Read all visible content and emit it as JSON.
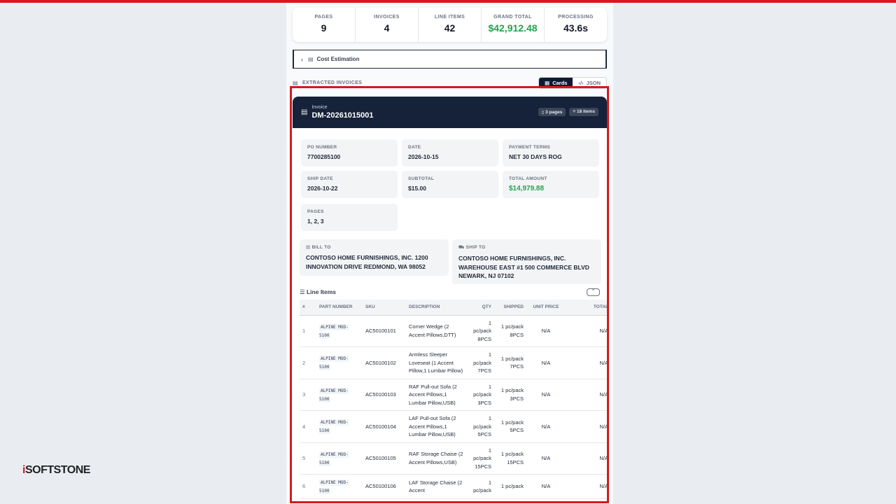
{
  "stats": [
    {
      "label": "PAGES",
      "value": "9"
    },
    {
      "label": "INVOICES",
      "value": "4"
    },
    {
      "label": "LINE ITEMS",
      "value": "42"
    },
    {
      "label": "GRAND TOTAL",
      "value": "$42,912.48"
    },
    {
      "label": "PROCESSING",
      "value": "43.6s"
    }
  ],
  "cost_estimation": {
    "label": "Cost Estimation"
  },
  "section": {
    "title": "EXTRACTED INVOICES",
    "cards_label": "Cards",
    "json_label": "JSON"
  },
  "invoice": {
    "kind": "Invoice",
    "number": "DM-20261015001",
    "pages_badge": "3 pages",
    "items_badge": "18 items",
    "fields": {
      "po_number": {
        "label": "PO NUMBER",
        "value": "7700285100"
      },
      "date": {
        "label": "DATE",
        "value": "2026-10-15"
      },
      "payment_terms": {
        "label": "PAYMENT TERMS",
        "value": "NET 30 DAYS ROG"
      },
      "ship_date": {
        "label": "SHIP DATE",
        "value": "2026-10-22"
      },
      "subtotal": {
        "label": "SUBTOTAL",
        "value": "$15.00"
      },
      "total_amount": {
        "label": "TOTAL AMOUNT",
        "value": "$14,979.88"
      },
      "pages": {
        "label": "PAGES",
        "value": "1, 2, 3"
      }
    },
    "bill_to": {
      "label": "BILL TO",
      "value": "CONTOSO HOME FURNISHINGS, INC. 1200 INNOVATION DRIVE REDMOND, WA 98052"
    },
    "ship_to": {
      "label": "SHIP TO",
      "value": "CONTOSO HOME FURNISHINGS, INC. WAREHOUSE EAST #1 500 COMMERCE BLVD NEWARK, NJ 07102"
    },
    "line_items_title": "Line Items",
    "columns": [
      "#",
      "PART NUMBER",
      "SKU",
      "DESCRIPTION",
      "QTY",
      "SHIPPED",
      "UNIT PRICE",
      "TOTAL"
    ],
    "rows": [
      {
        "n": "1",
        "part": "ALPINE MOD-5100",
        "sku": "AC50100101",
        "desc": "Corner Wedge (2 Accent Pillows,DTT)",
        "qty": "1 pc/pack 8PCS",
        "shipped": "1 pc/pack 8PCS",
        "unit": "N/A",
        "total": "N/A"
      },
      {
        "n": "2",
        "part": "ALPINE MOD-5100",
        "sku": "AC50100102",
        "desc": "Armless Sleeper Loveseat (1 Accent Pillow,1 Lumbar Pillow)",
        "qty": "1 pc/pack 7PCS",
        "shipped": "1 pc/pack 7PCS",
        "unit": "N/A",
        "total": "N/A"
      },
      {
        "n": "3",
        "part": "ALPINE MOD-5100",
        "sku": "AC50100103",
        "desc": "RAF Pull-out Sofa (2 Accent Pillows,1 Lumbar Pillow,USB)",
        "qty": "1 pc/pack 3PCS",
        "shipped": "1 pc/pack 3PCS",
        "unit": "N/A",
        "total": "N/A"
      },
      {
        "n": "4",
        "part": "ALPINE MOD-5100",
        "sku": "AC50100104",
        "desc": "LAF Pull-out Sofa (2 Accent Pillows,1 Lumbar Pillow,USB)",
        "qty": "1 pc/pack 5PCS",
        "shipped": "1 pc/pack 5PCS",
        "unit": "N/A",
        "total": "N/A"
      },
      {
        "n": "5",
        "part": "ALPINE MOD-5100",
        "sku": "AC50100105",
        "desc": "RAF Storage Chaise (2 Accent Pillows,USB)",
        "qty": "1 pc/pack 15PCS",
        "shipped": "1 pc/pack 15PCS",
        "unit": "N/A",
        "total": "N/A"
      },
      {
        "n": "6",
        "part": "ALPINE MOD-5100",
        "sku": "AC50100106",
        "desc": "LAF Storage Chaise (2 Accent",
        "qty": "1 pc/pack",
        "shipped": "1 pc/pack",
        "unit": "N/A",
        "total": "N/A"
      }
    ]
  },
  "logo": {
    "mark": "i",
    "text": "SOFTSTONE"
  }
}
